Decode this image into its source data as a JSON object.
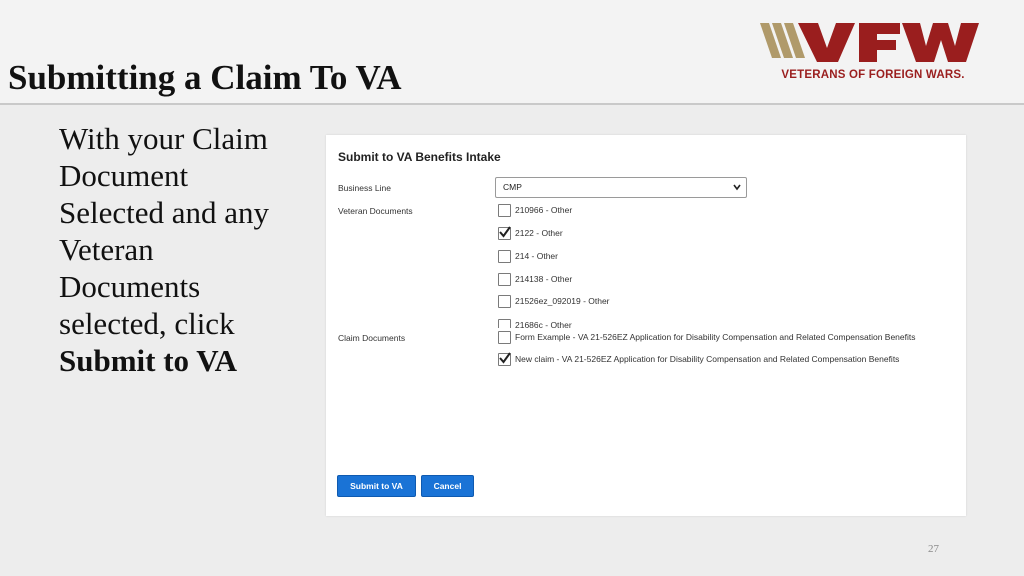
{
  "slide": {
    "title": "Submitting a Claim To VA",
    "page_number": "27",
    "body": {
      "lines": [
        "With your Claim",
        "Document",
        "Selected and any",
        "Veteran",
        "Documents",
        "selected, click"
      ],
      "emphasis": "Submit to VA"
    }
  },
  "logo": {
    "wordmark": "VFW",
    "tagline": "VETERANS OF FOREIGN WARS.",
    "colors": {
      "gold": "#b09a6a",
      "red": "#9a1e1e"
    }
  },
  "form": {
    "title": "Submit to VA Benefits Intake",
    "business_line": {
      "label": "Business Line",
      "value": "CMP"
    },
    "veteran_documents": {
      "label": "Veteran Documents",
      "items": [
        {
          "label": "210966 - Other",
          "checked": false
        },
        {
          "label": "2122 - Other",
          "checked": true
        },
        {
          "label": "214 - Other",
          "checked": false
        },
        {
          "label": "214138 - Other",
          "checked": false
        },
        {
          "label": "21526ez_092019 - Other",
          "checked": false
        },
        {
          "label": "21686c - Other",
          "checked": false
        }
      ]
    },
    "claim_documents": {
      "label": "Claim Documents",
      "items": [
        {
          "label": "Form Example - VA 21-526EZ Application for Disability Compensation and Related Compensation Benefits",
          "checked": false
        },
        {
          "label": "New claim - VA 21-526EZ Application for Disability Compensation and Related Compensation Benefits",
          "checked": true
        }
      ]
    },
    "buttons": {
      "submit": "Submit to VA",
      "cancel": "Cancel"
    },
    "accent_color": "#1a73d6"
  }
}
